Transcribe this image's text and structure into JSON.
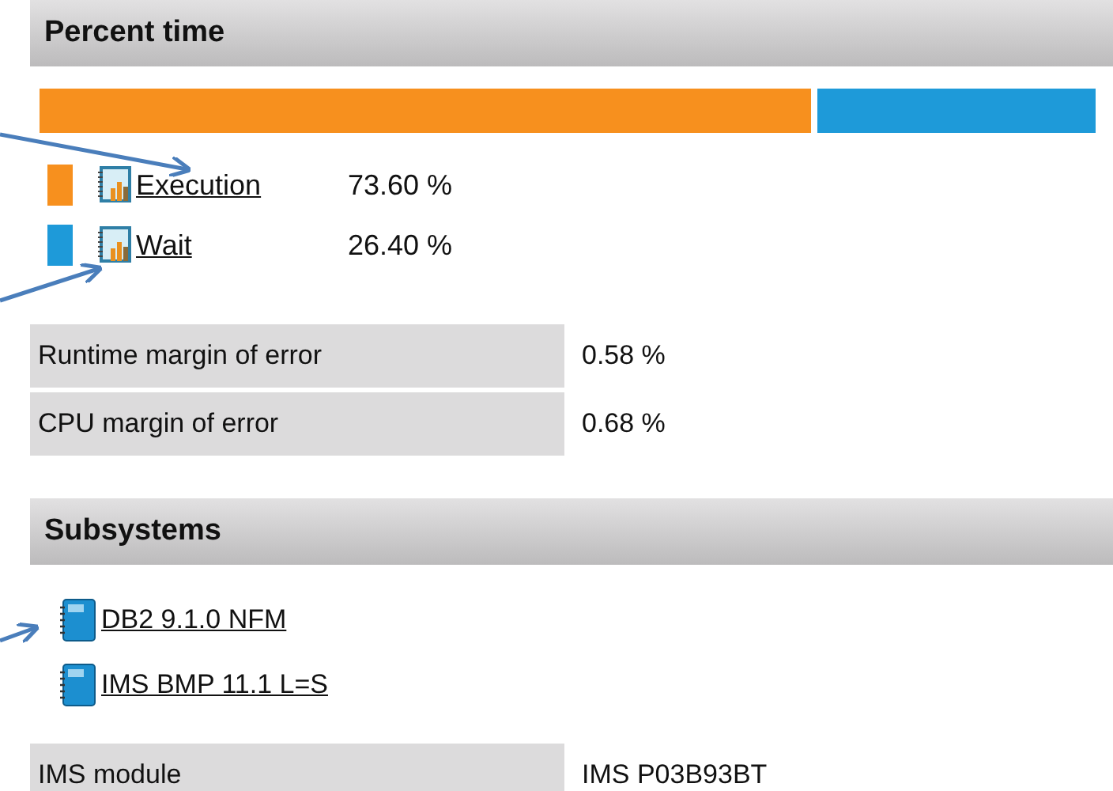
{
  "percent_time": {
    "title": "Percent time",
    "bar": {
      "level": 0.736
    },
    "segments": [
      {
        "label": "Execution",
        "value": "73.60 %",
        "color": "#f7901e"
      },
      {
        "label": "Wait",
        "value": "26.40 %",
        "color": "#1e9ad9"
      }
    ]
  },
  "metrics": [
    {
      "label": "Runtime margin of error",
      "value": "0.58 %"
    },
    {
      "label": "CPU margin of error",
      "value": "0.68 %"
    }
  ],
  "subsystems": {
    "title": "Subsystems",
    "items": [
      {
        "label": "DB2 9.1.0 NFM"
      },
      {
        "label": "IMS BMP 11.1 L=S"
      }
    ]
  },
  "details": [
    {
      "label": "IMS module",
      "value": "IMS P03B93BT"
    }
  ]
}
